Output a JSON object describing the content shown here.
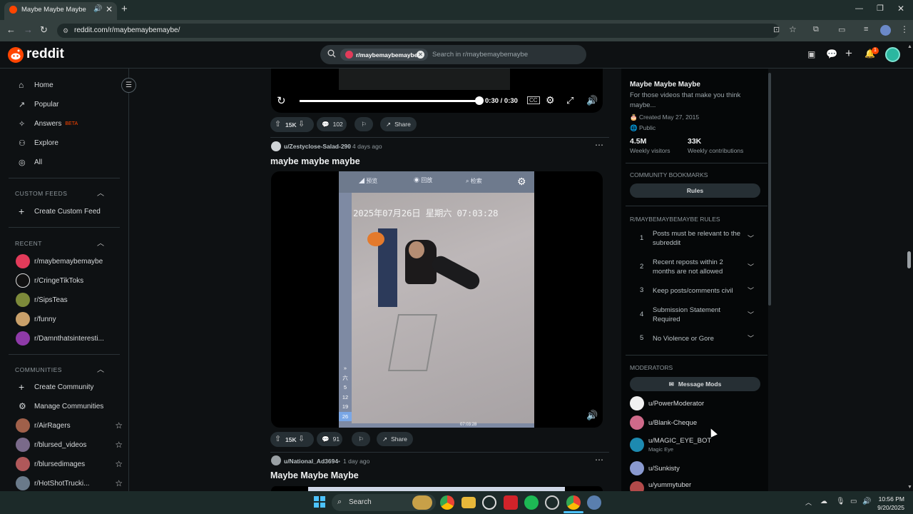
{
  "browser": {
    "tab_title": "Maybe Maybe Maybe",
    "url": "reddit.com/r/maybemaybemaybe/"
  },
  "header": {
    "logo": "reddit",
    "subreddit_chip": "r/maybemaybemaybe",
    "search_placeholder": "Search in r/maybemaybemaybe",
    "notification_count": "1"
  },
  "left_nav": {
    "main": [
      {
        "label": "Home",
        "icon": "home-icon"
      },
      {
        "label": "Popular",
        "icon": "popular-icon"
      },
      {
        "label": "Answers",
        "icon": "answers-icon",
        "badge": "BETA"
      },
      {
        "label": "Explore",
        "icon": "explore-icon"
      },
      {
        "label": "All",
        "icon": "all-icon"
      }
    ],
    "custom_feeds_title": "CUSTOM FEEDS",
    "create_custom_feed": "Create Custom Feed",
    "recent_title": "RECENT",
    "recent": [
      "r/maybemaybemaybe",
      "r/CringeTikToks",
      "r/SipsTeas",
      "r/funny",
      "r/Damnthatsinteresti..."
    ],
    "communities_title": "COMMUNITIES",
    "create_community": "Create Community",
    "manage_communities": "Manage Communities",
    "communities": [
      "r/AirRagers",
      "r/blursed_videos",
      "r/blursedimages",
      "r/HotShotTrucki..."
    ]
  },
  "player": {
    "time": "0:30 / 0:30",
    "progress": 1.0
  },
  "posts": [
    {
      "votes": "15K",
      "comments": "102",
      "share": "Share"
    },
    {
      "author": "u/Zestyclose-Salad-290",
      "age": "4 days ago",
      "title": "maybe maybe maybe",
      "votes": "15K",
      "comments": "91",
      "share": "Share",
      "video_overlay": {
        "tab1": "预览",
        "tab2": "回放",
        "tab3": "检索",
        "timestamp": "2025年07月26日 星期六 07:03:28",
        "side": [
          "»",
          "六",
          "5",
          "12",
          "19",
          "26"
        ],
        "bottom": "07:03:28"
      }
    },
    {
      "author": "u/National_Ad3694",
      "age": "1 day ago",
      "title": "Maybe Maybe Maybe"
    }
  ],
  "sidebar": {
    "title": "Maybe Maybe Maybe",
    "description_line1": "For those videos that make you think",
    "description_line2": "maybe...",
    "created": "Created May 27, 2015",
    "visibility": "Public",
    "stats": [
      {
        "value": "4.5M",
        "label": "Weekly visitors"
      },
      {
        "value": "33K",
        "label": "Weekly contributions"
      }
    ],
    "bookmarks_title": "COMMUNITY BOOKMARKS",
    "rules_button": "Rules",
    "rules_title": "R/MAYBEMAYBEMAYBE RULES",
    "rules": [
      {
        "n": "1",
        "l1": "Posts must be relevant to the",
        "l2": "subreddit"
      },
      {
        "n": "2",
        "l1": "Recent reposts within 2",
        "l2": "months are not allowed"
      },
      {
        "n": "3",
        "l1": "Keep posts/comments civil",
        "l2": ""
      },
      {
        "n": "4",
        "l1": "Submission Statement",
        "l2": "Required"
      },
      {
        "n": "5",
        "l1": "No Violence or Gore",
        "l2": ""
      }
    ],
    "moderators_title": "MODERATORS",
    "message_mods": "Message Mods",
    "moderators": [
      {
        "name": "u/PowerModerator",
        "flair": ""
      },
      {
        "name": "u/Blank-Cheque",
        "flair": ""
      },
      {
        "name": "u/MAGIC_EYE_BOT",
        "flair": "Magic Eye"
      },
      {
        "name": "u/Sunkisty",
        "flair": ""
      },
      {
        "name": "u/yummytuber",
        "flair": ""
      }
    ]
  },
  "taskbar": {
    "search": "Search",
    "time": "10:56 PM",
    "date": "9/20/2025"
  },
  "colors": {
    "accent": "#ff4500",
    "bg": "#0e1113",
    "chrome": "#1f2d2c"
  }
}
